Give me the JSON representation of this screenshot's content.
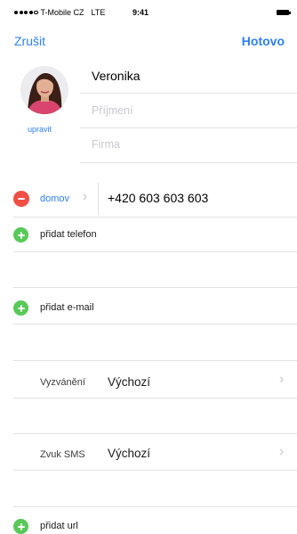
{
  "status_bar": {
    "carrier": "T-Mobile CZ",
    "network": "LTE",
    "time": "9:41"
  },
  "nav": {
    "cancel_label": "Zrušit",
    "done_label": "Hotovo"
  },
  "contact": {
    "photo_edit_label": "upravit",
    "first_name": "Veronika",
    "last_name_placeholder": "Příjmení",
    "company_placeholder": "Firma"
  },
  "phone": {
    "label": "domov",
    "number": "+420 603 603 603"
  },
  "actions": {
    "add_phone": "přidat telefon",
    "add_email": "přidat e-mail",
    "add_url": "přidat url"
  },
  "settings": {
    "ringtone_label": "Vyzvánění",
    "ringtone_value": "Výchozí",
    "sms_label": "Zvuk SMS",
    "sms_value": "Výchozí"
  },
  "colors": {
    "accent": "#2d7ff4",
    "delete": "#f14e44",
    "add": "#57c957",
    "separator": "#e1e1e4"
  },
  "icons": [
    "minus-circle-icon",
    "plus-circle-icon",
    "chevron-right-icon",
    "battery-icon",
    "signal-icon"
  ]
}
